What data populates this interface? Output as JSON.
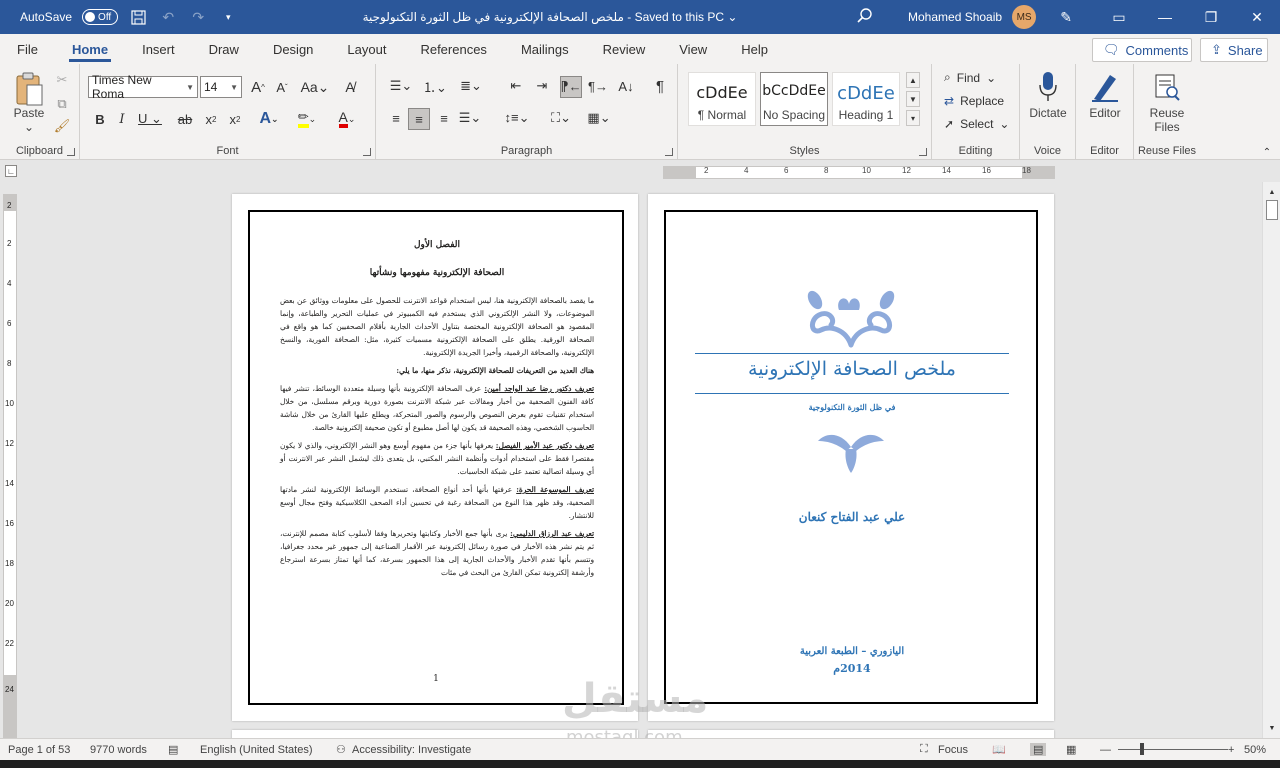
{
  "titlebar": {
    "autosave_label": "AutoSave",
    "autosave_state": "Off",
    "doc_title": "ملخص الصحافة الإلكترونية في ظل الثورة التكنولوجية - Saved to this PC",
    "user_name": "Mohamed Shoaib",
    "user_initials": "MS"
  },
  "tabs": [
    "File",
    "Home",
    "Insert",
    "Draw",
    "Design",
    "Layout",
    "References",
    "Mailings",
    "Review",
    "View",
    "Help"
  ],
  "comments_label": "Comments",
  "share_label": "Share",
  "ribbon": {
    "paste": "Paste",
    "font_name": "Times New Roma",
    "font_size": "14",
    "clipboard": "Clipboard",
    "font": "Font",
    "paragraph": "Paragraph",
    "styles": "Styles",
    "editing": "Editing",
    "voice": "Voice",
    "editor": "Editor",
    "reuse_files_group": "Reuse Files",
    "style_items": [
      {
        "preview": "cDdEe",
        "name": "¶ Normal"
      },
      {
        "preview": "bCcDdEe",
        "name": "No Spacing"
      },
      {
        "preview": "cDdEe",
        "name": "Heading 1"
      }
    ],
    "find": "Find",
    "replace": "Replace",
    "select": "Select",
    "dictate": "Dictate",
    "editor_btn": "Editor",
    "reuse_line1": "Reuse",
    "reuse_line2": "Files"
  },
  "ruler_numbers": [
    "2",
    "4",
    "6",
    "8",
    "10",
    "12",
    "14",
    "16",
    "18"
  ],
  "vruler_numbers": [
    "2",
    "2",
    "4",
    "6",
    "8",
    "10",
    "12",
    "14",
    "16",
    "18",
    "20",
    "22",
    "24"
  ],
  "cover": {
    "title": "ملخص الصحافة الإلكترونية",
    "subtitle": "في ظل الثورة التكنولوجية",
    "author": "علي عبد الفتاح كنعان",
    "publisher": "اليازوري – الطبعة العربية",
    "year": "2014م"
  },
  "content": {
    "chapter": "الفصل الأول",
    "heading": "الصحافة الإلكترونية مفهومها ونشأتها",
    "p1": "ما يقصد بالصحافة الإلكترونية هنا، ليس استخدام قواعد الانترنت للحصول على معلومات ووثائق عن بعض الموضوعات، ولا النشر الإلكتروني الذي يستخدم فيه الكمبيوتر في عمليات التحرير والطباعة، وإنما المقصود هو الصحافة الإلكترونية المختصة بتناول الأحداث الجارية بأقلام الصحفيين كما هو واقع في الصحافة الورقية. يطلق على الصحافة الإلكترونية مسميات كثيرة، مثل: الصحافة الفورية، والنسخ الإلكترونية، والصحافة الرقمية، وأخيرا الجريدة الإلكترونية.",
    "p2": "هناك العديد من التعريفات للصحافة الإلكترونية، نذكر منها، ما يلي:",
    "d1_term": "تعريف دكتور رضا عبد الواجد أمين:",
    "d1": " عرف الصحافة الإلكترونية بأنها وسيلة متعددة الوسائط، تنشر فيها كافة الفنون الصحفية من أخبار ومقالات عبر شبكة الانترنت بصورة دورية وبرقم مسلسل، من خلال استخدام تقنيات تقوم بعرض النصوص والرسوم والصور المتحركة، ويطلع عليها القارئ من خلال شاشة الحاسوب الشخصي، وهذه الصحيفة قد يكون لها أصل مطبوع أو تكون صحيفة إلكترونية خالصة.",
    "d2_term": "تعريف دكتور عبد الأمير الفيصل:",
    "d2": " يعرفها بأنها جزء من مفهوم أوسع وهو النشر الإلكتروني، والذي لا يكون مقتصرا فقط على استخدام أدوات وأنظمة النشر المكتبي، بل يتعدى ذلك ليشمل النشر عبر الانترنت أو أي وسيلة اتصالية تعتمد على شبكة الحاسبات.",
    "d3_term": "تعريف الموسوعة الحرة:",
    "d3": " عرفتها بأنها أحد أنواع الصحافة، تستخدم الوسائط الإلكترونية لنشر مادتها الصحفية، وقد ظهر هذا النوع من الصحافة رغبة في تحسين أداء الصحف الكلاسيكية وفتح مجال أوسع للانتشار.",
    "d4_term": "تعريف عبد الرزاق الدليمي:",
    "d4": " يرى بأنها جمع الأخبار وكتابتها وتحريرها وفقا لأسلوب كتابة مصمم للإنترنت، ثم يتم نشر هذه الأخبار في صورة رسائل إلكترونية عبر الأقمار الصناعية إلى جمهور غير محدد جغرافيا، وتتسم بأنها تقدم الأخبار والأحداث الجارية إلى هذا الجمهور بسرعة، كما أنها تمتاز بسرعة استرجاع وأرشفة إلكترونية تمكن القارئ من البحث في مئات",
    "page_number": "1"
  },
  "status": {
    "page": "Page 1 of 53",
    "words": "9770 words",
    "language": "English (United States)",
    "accessibility": "Accessibility: Investigate",
    "focus": "Focus",
    "zoom": "50%"
  },
  "watermark": {
    "big": "مستقل",
    "small": "mostaql.com"
  },
  "colors": {
    "brand": "#2b579a",
    "cover_text": "#2e74b5",
    "ornament": "#8eaadb"
  }
}
